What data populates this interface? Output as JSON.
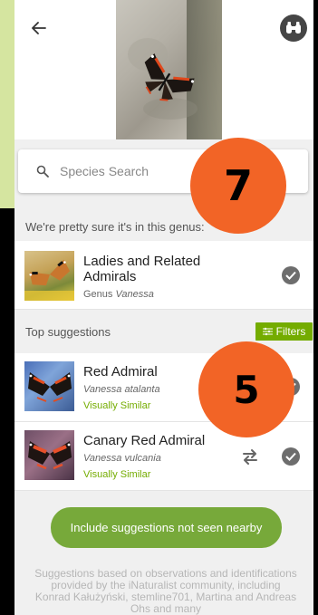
{
  "search": {
    "placeholder": "Species Search"
  },
  "genus_section": {
    "label": "We're pretty sure it's in this genus:",
    "name_line1": "Ladies and Related",
    "name_line2": "Admirals",
    "rank": "Genus",
    "scientific": "Vanessa"
  },
  "top_section": {
    "label": "Top suggestions",
    "filters_label": "Filters",
    "items": [
      {
        "name": "Red Admiral",
        "scientific": "Vanessa atalanta",
        "tag": "Visually Similar"
      },
      {
        "name": "Canary Red Admiral",
        "scientific": "Vanessa vulcania",
        "tag": "Visually Similar"
      }
    ]
  },
  "include_button": "Include suggestions not seen nearby",
  "footer": "Suggestions based on observations and identifications provided by the iNaturalist community, including Konrad Kałużyński, stemline701, Martina and Andreas Ohs and many",
  "badges": {
    "top": "7",
    "bottom": "5"
  },
  "colors": {
    "accent_green": "#74ac00",
    "badge_orange": "#f26426"
  },
  "icons": [
    "back-arrow-icon",
    "binoculars-icon",
    "search-icon",
    "check-icon",
    "filter-icon",
    "compare-icon"
  ]
}
